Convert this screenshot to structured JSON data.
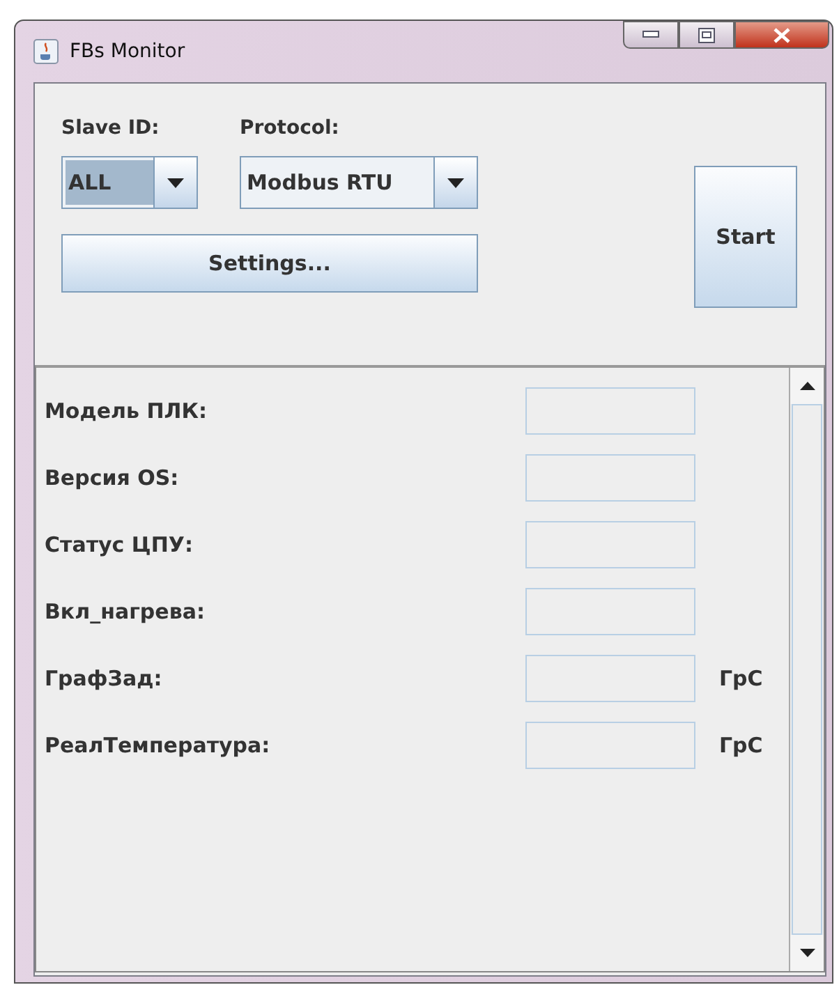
{
  "window": {
    "title": "FBs Monitor"
  },
  "slave_id": {
    "label": "Slave ID:",
    "value": "ALL"
  },
  "protocol": {
    "label": "Protocol:",
    "value": "Modbus RTU"
  },
  "settings_button": "Settings...",
  "start_button": "Start",
  "fields": [
    {
      "label": "Модель ПЛК:"
    },
    {
      "label": "Версия OS:"
    },
    {
      "label": "Статус ЦПУ:"
    },
    {
      "label": "Вкл_нагрева:"
    },
    {
      "label": "ГрафЗад:",
      "unit": "ГрС"
    },
    {
      "label": "РеалТемпература:",
      "unit": "ГрС"
    }
  ]
}
